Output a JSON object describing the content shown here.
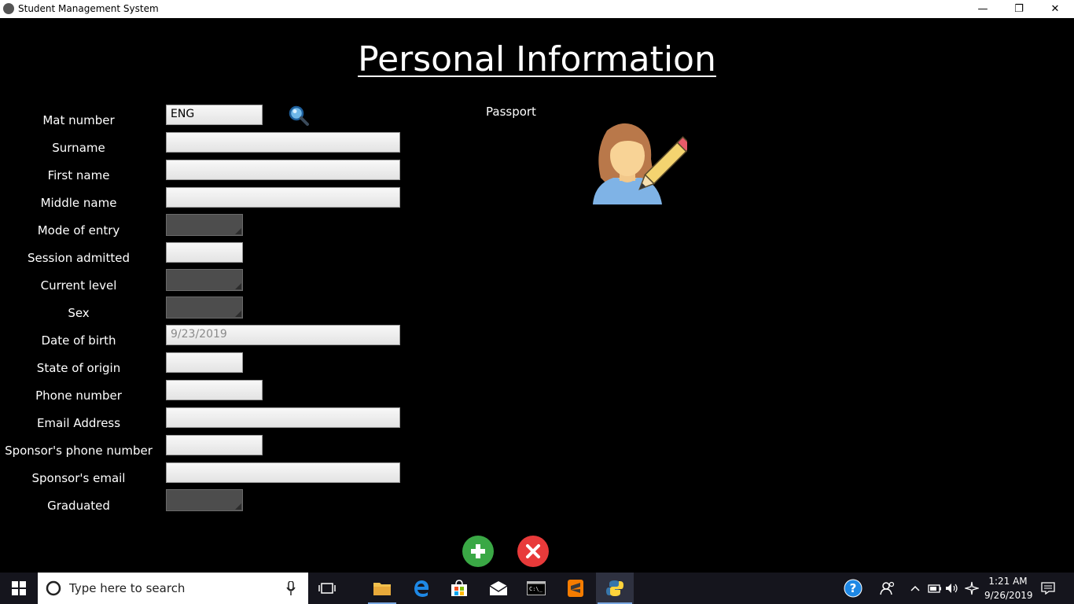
{
  "window": {
    "title": "Student Management System"
  },
  "heading": "Personal Information",
  "form": {
    "fields": [
      {
        "label": "Mat number",
        "value": "ENG"
      },
      {
        "label": "Surname",
        "value": ""
      },
      {
        "label": "First name",
        "value": ""
      },
      {
        "label": "Middle name",
        "value": ""
      },
      {
        "label": "Mode of entry",
        "value": ""
      },
      {
        "label": "Session admitted",
        "value": ""
      },
      {
        "label": "Current level",
        "value": ""
      },
      {
        "label": "Sex",
        "value": ""
      },
      {
        "label": "Date of birth",
        "placeholder": "9/23/2019"
      },
      {
        "label": "State of origin",
        "value": ""
      },
      {
        "label": "Phone number",
        "value": ""
      },
      {
        "label": "Email Address",
        "value": ""
      },
      {
        "label": "Sponsor's phone number",
        "value": ""
      },
      {
        "label": "Sponsor's email",
        "value": ""
      },
      {
        "label": "Graduated",
        "value": ""
      }
    ]
  },
  "passport": {
    "label": "Passport",
    "icon": "avatar-edit-icon"
  },
  "actions": {
    "add_icon": "plus-icon",
    "cancel_icon": "close-icon",
    "add_color": "#3aa845",
    "cancel_color": "#e83a3a"
  },
  "taskbar": {
    "search_placeholder": "Type here to search",
    "time": "1:21 AM",
    "date": "9/26/2019"
  }
}
